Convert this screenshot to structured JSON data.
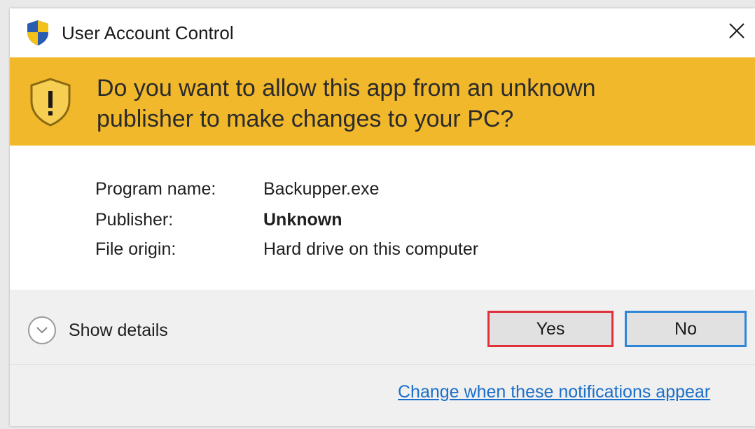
{
  "window": {
    "title": "User Account Control",
    "close_icon": "close-icon",
    "app_icon": "uac-shield-icon"
  },
  "banner": {
    "icon": "warning-shield-icon",
    "line1": "Do you want to allow this app from an unknown",
    "line2": "publisher to make changes to your PC?",
    "background": "#f1b82b"
  },
  "details": {
    "rows": [
      {
        "label": "Program name:",
        "value": "Backupper.exe"
      },
      {
        "label": "Publisher:",
        "value": "Unknown"
      },
      {
        "label": "File origin:",
        "value": "Hard drive on this computer"
      }
    ]
  },
  "actions": {
    "show_details_label": "Show details",
    "yes_label": "Yes",
    "no_label": "No",
    "change_link": "Change when these notifications appear",
    "yes_border": "#e0303a",
    "no_border": "#2f86d9",
    "link_color": "#1c6fc9"
  }
}
